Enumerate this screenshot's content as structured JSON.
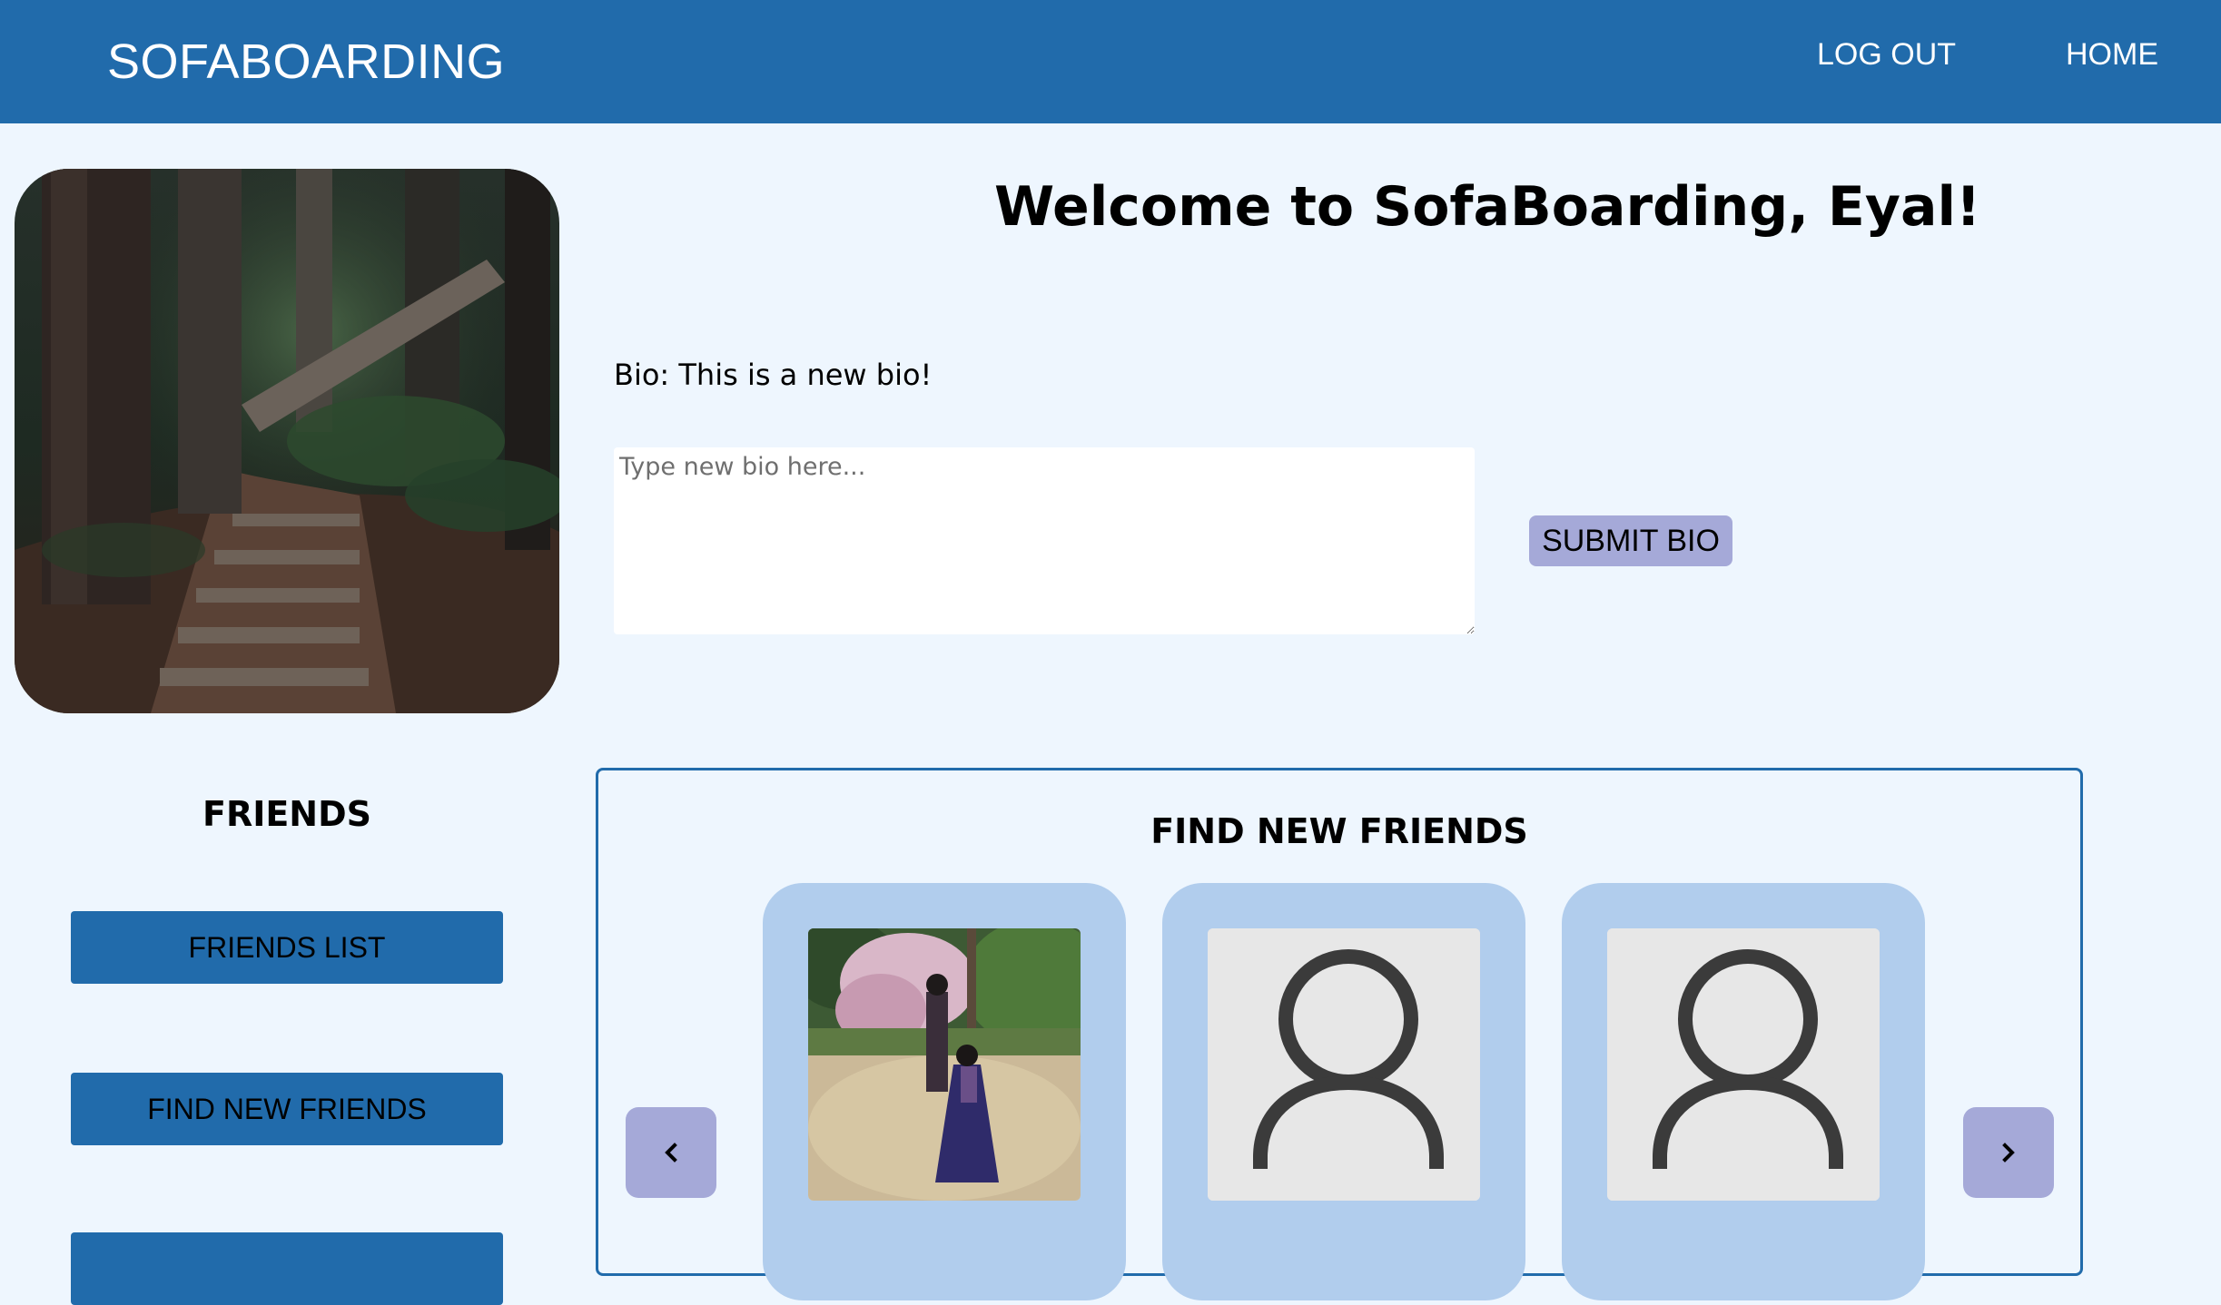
{
  "header": {
    "brand": "SOFABOARDING",
    "nav": {
      "logout": "LOG OUT",
      "home": "HOME"
    },
    "color": "#216bab"
  },
  "profile": {
    "image_icon": "forest-path-photo",
    "welcome": "Welcome to SofaBoarding, Eyal!",
    "bio": "Bio: This is a new bio!",
    "bio_placeholder": "Type new bio here...",
    "submit_label": "SUBMIT BIO"
  },
  "friends_sidebar": {
    "heading": "FRIENDS",
    "buttons": {
      "friends_list": "FRIENDS LIST",
      "find_new_friends": "FIND NEW FRIENDS"
    }
  },
  "find_friends": {
    "title": "FIND NEW FRIENDS",
    "cards": [
      {
        "image_icon": "user-photo"
      },
      {
        "image_icon": "default-avatar-icon"
      },
      {
        "image_icon": "default-avatar-icon"
      }
    ],
    "prev_icon": "chevron-left-icon",
    "next_icon": "chevron-right-icon"
  },
  "colors": {
    "page_bg": "#eef6fe",
    "accent_button": "#a5a9d8",
    "card_bg": "#b1cded"
  }
}
